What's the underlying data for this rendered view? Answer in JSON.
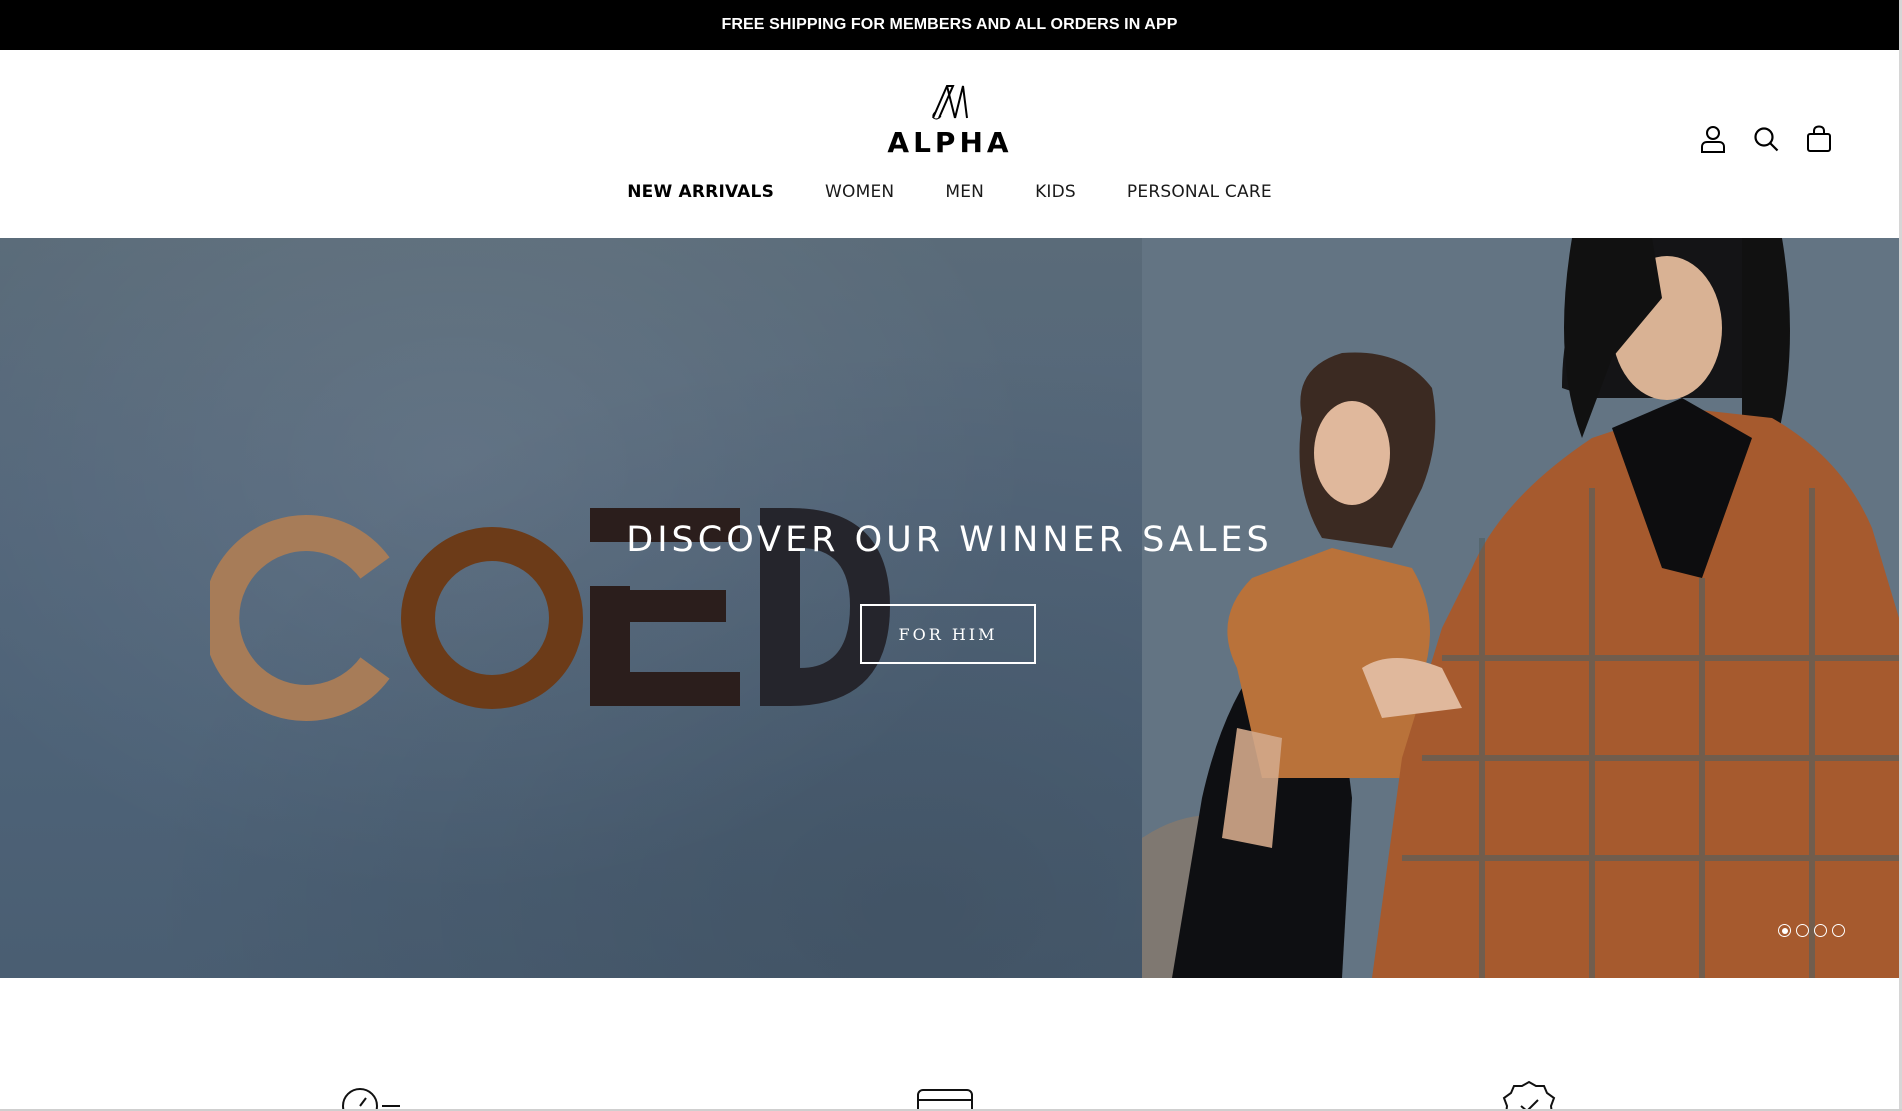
{
  "announcement": {
    "text": "FREE SHIPPING FOR MEMBERS AND ALL ORDERS IN APP"
  },
  "header": {
    "logo_text": "ALPHA",
    "icons": [
      "account-icon",
      "search-icon",
      "cart-icon"
    ]
  },
  "nav": {
    "items": [
      {
        "label": "NEW ARRIVALS",
        "active": true
      },
      {
        "label": "WOMEN",
        "active": false
      },
      {
        "label": "MEN",
        "active": false
      },
      {
        "label": "KIDS",
        "active": false
      },
      {
        "label": "PERSONAL CARE",
        "active": false
      }
    ]
  },
  "hero": {
    "image_text": "COED",
    "title": "DISCOVER OUR WINNER SALES",
    "cta_label": "FOR HIM",
    "slides": 4,
    "active_slide": 1
  },
  "features": {
    "icons": [
      "fast-delivery-icon",
      "credit-card-icon",
      "quality-badge-icon"
    ]
  },
  "colors": {
    "announcement_bg": "#000000",
    "hero_bg": "#4f6272",
    "text_dark": "#1a1a1a",
    "white": "#ffffff"
  }
}
